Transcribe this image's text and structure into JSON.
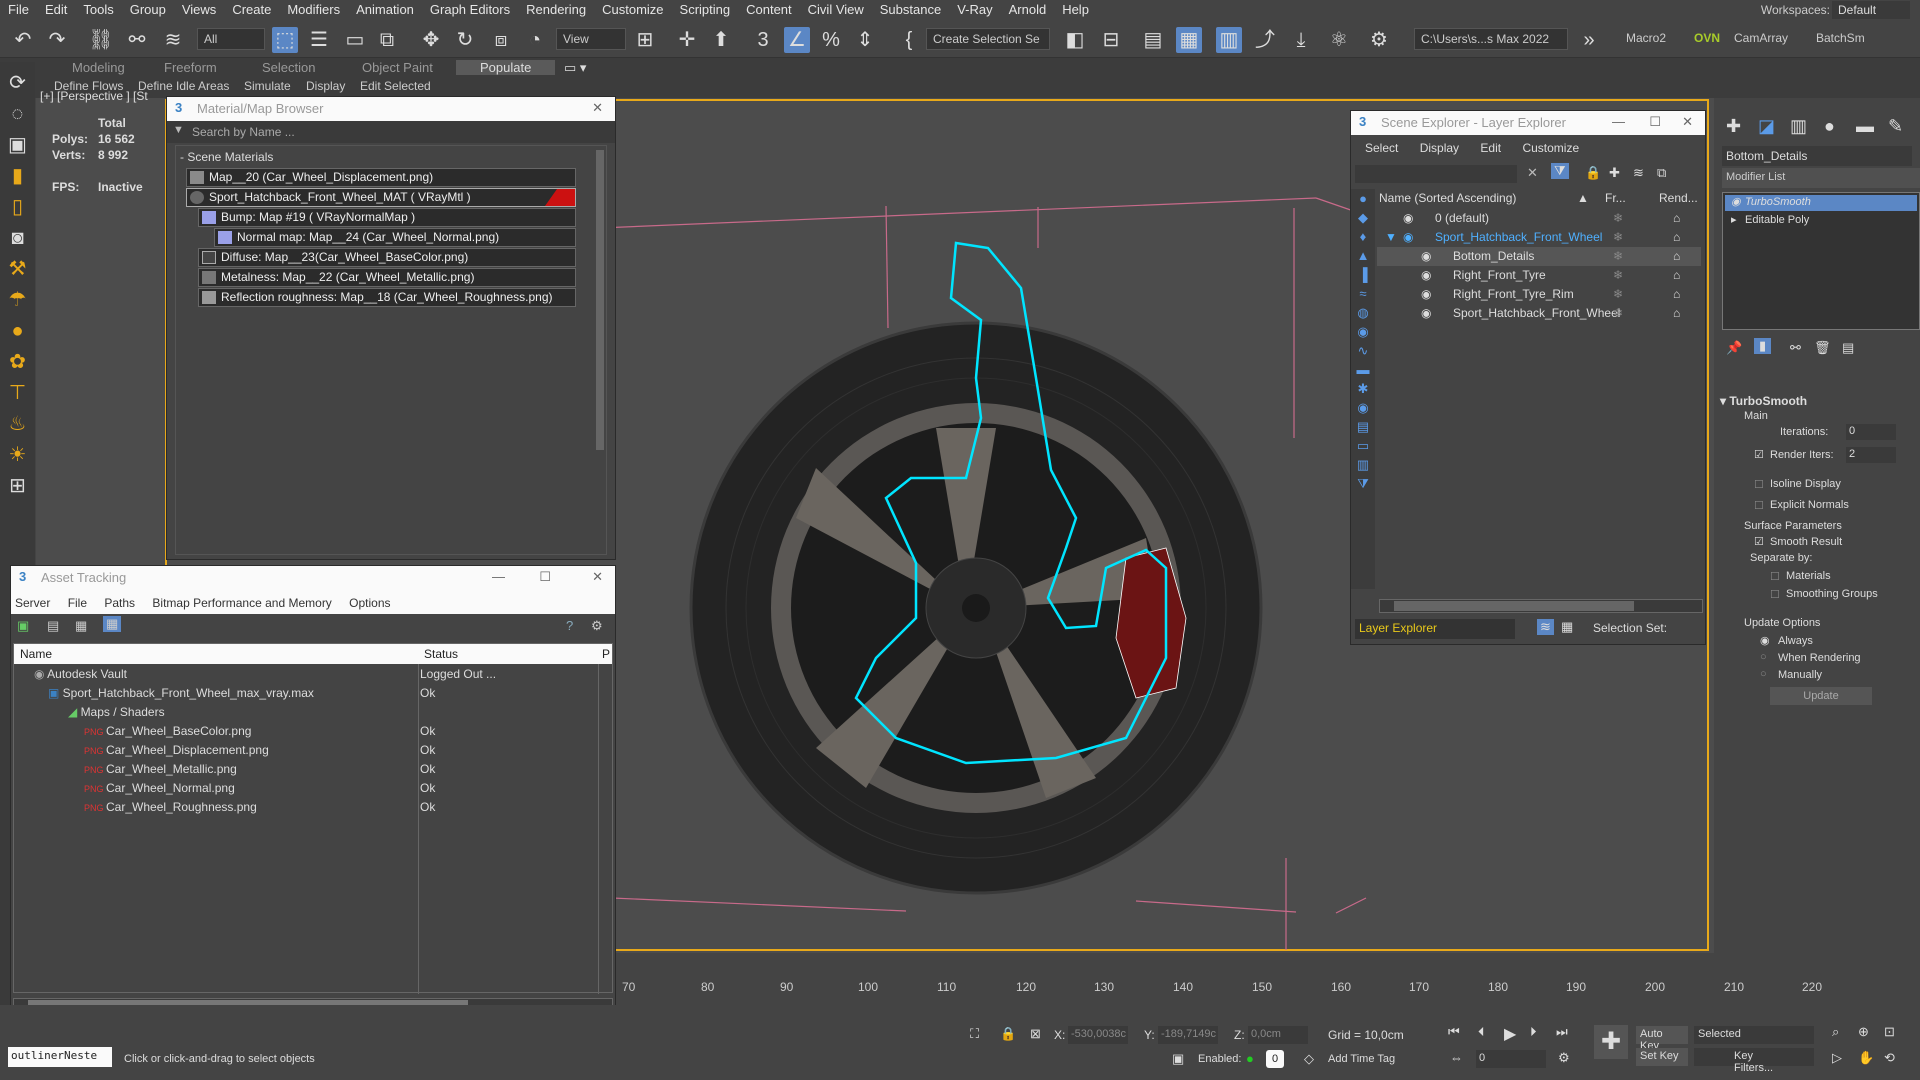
{
  "menu": [
    "File",
    "Edit",
    "Tools",
    "Group",
    "Views",
    "Create",
    "Modifiers",
    "Animation",
    "Graph Editors",
    "Rendering",
    "Customize",
    "Scripting",
    "Content",
    "Civil View",
    "Substance",
    "V-Ray",
    "Arnold",
    "Help"
  ],
  "workspaces": {
    "label": "Workspaces:",
    "value": "Default"
  },
  "toolbar": {
    "filter": "All",
    "view": "View",
    "create_sel": "Create Selection Se",
    "path": "C:\\Users\\s...s Max 2022",
    "macro": "Macro2",
    "ovn": "OVN",
    "camarray": "CamArray",
    "batch": "BatchSm"
  },
  "ribbon": {
    "tabs": [
      "Modeling",
      "Freeform",
      "Selection",
      "Object Paint",
      "Populate"
    ],
    "subs": [
      "Define Flows",
      "Define Idle Areas",
      "Simulate",
      "Display",
      "Edit Selected"
    ]
  },
  "viewport": {
    "label": "[+] [Perspective ] [St",
    "total": "Total",
    "polys_label": "Polys:",
    "polys": "16 562",
    "verts_label": "Verts:",
    "verts": "8 992",
    "fps_label": "FPS:",
    "fps": "Inactive"
  },
  "material_browser": {
    "title": "Material/Map Browser",
    "search": "Search by Name ...",
    "group": "- Scene Materials",
    "rows": [
      "Map__20 (Car_Wheel_Displacement.png)",
      "Sport_Hatchback_Front_Wheel_MAT ( VRayMtl )",
      "Bump: Map #19 ( VRayNormalMap )",
      "Normal map: Map__24 (Car_Wheel_Normal.png)",
      "Diffuse: Map__23(Car_Wheel_BaseColor.png)",
      "Metalness: Map__22 (Car_Wheel_Metallic.png)",
      "Reflection roughness: Map__18 (Car_Wheel_Roughness.png)"
    ]
  },
  "asset_tracking": {
    "title": "Asset Tracking",
    "menu": [
      "Server",
      "File",
      "Paths",
      "Bitmap Performance and Memory",
      "Options"
    ],
    "col_name": "Name",
    "col_status": "Status",
    "col_p": "P",
    "rows": [
      {
        "name": "Autodesk Vault",
        "status": "Logged Out ..."
      },
      {
        "name": "Sport_Hatchback_Front_Wheel_max_vray.max",
        "status": "Ok"
      },
      {
        "name": "Maps / Shaders",
        "status": ""
      },
      {
        "name": "Car_Wheel_BaseColor.png",
        "status": "Ok"
      },
      {
        "name": "Car_Wheel_Displacement.png",
        "status": "Ok"
      },
      {
        "name": "Car_Wheel_Metallic.png",
        "status": "Ok"
      },
      {
        "name": "Car_Wheel_Normal.png",
        "status": "Ok"
      },
      {
        "name": "Car_Wheel_Roughness.png",
        "status": "Ok"
      }
    ]
  },
  "scene_explorer": {
    "title": "Scene Explorer - Layer Explorer",
    "menu": [
      "Select",
      "Display",
      "Edit",
      "Customize"
    ],
    "col_name": "Name (Sorted Ascending)",
    "col_fr": "Fr...",
    "col_rend": "Rend...",
    "rows": [
      "0 (default)",
      "Sport_Hatchback_Front_Wheel",
      "Bottom_Details",
      "Right_Front_Tyre",
      "Right_Front_Tyre_Rim",
      "Sport_Hatchback_Front_Wheel"
    ],
    "footer_left": "Layer Explorer",
    "footer_right": "Selection Set:"
  },
  "command_panel": {
    "object_name": "Bottom_Details",
    "modifier_list": "Modifier List",
    "stack": [
      "TurboSmooth",
      "Editable Poly"
    ],
    "rollout": "TurboSmooth",
    "main": "Main",
    "iterations_label": "Iterations:",
    "iterations": "0",
    "render_iters_label": "Render Iters:",
    "render_iters": "2",
    "isoline": "Isoline Display",
    "explicit": "Explicit Normals",
    "surface": "Surface Parameters",
    "smooth": "Smooth Result",
    "separate": "Separate by:",
    "materials": "Materials",
    "smoothing": "Smoothing Groups",
    "update_options": "Update Options",
    "always": "Always",
    "when_rendering": "When Rendering",
    "manually": "Manually",
    "update": "Update"
  },
  "timeline": {
    "ticks": [
      "70",
      "80",
      "90",
      "100",
      "110",
      "120",
      "130",
      "140",
      "150",
      "160",
      "170",
      "180",
      "190",
      "200",
      "210",
      "220"
    ]
  },
  "status": {
    "script": "outlinerNeste",
    "prompt": "Click or click-and-drag to select objects",
    "x_label": "X:",
    "x": "-530,0038c",
    "y_label": "Y:",
    "y": "-189,7149c",
    "z_label": "Z:",
    "z": "0,0cm",
    "grid": "Grid = 10,0cm",
    "enabled": "Enabled:",
    "add_time_tag": "Add Time Tag",
    "autokey": "Auto Key",
    "setkey": "Set Key",
    "selected": "Selected",
    "keyfilters": "Key Filters...",
    "frame": "0"
  }
}
